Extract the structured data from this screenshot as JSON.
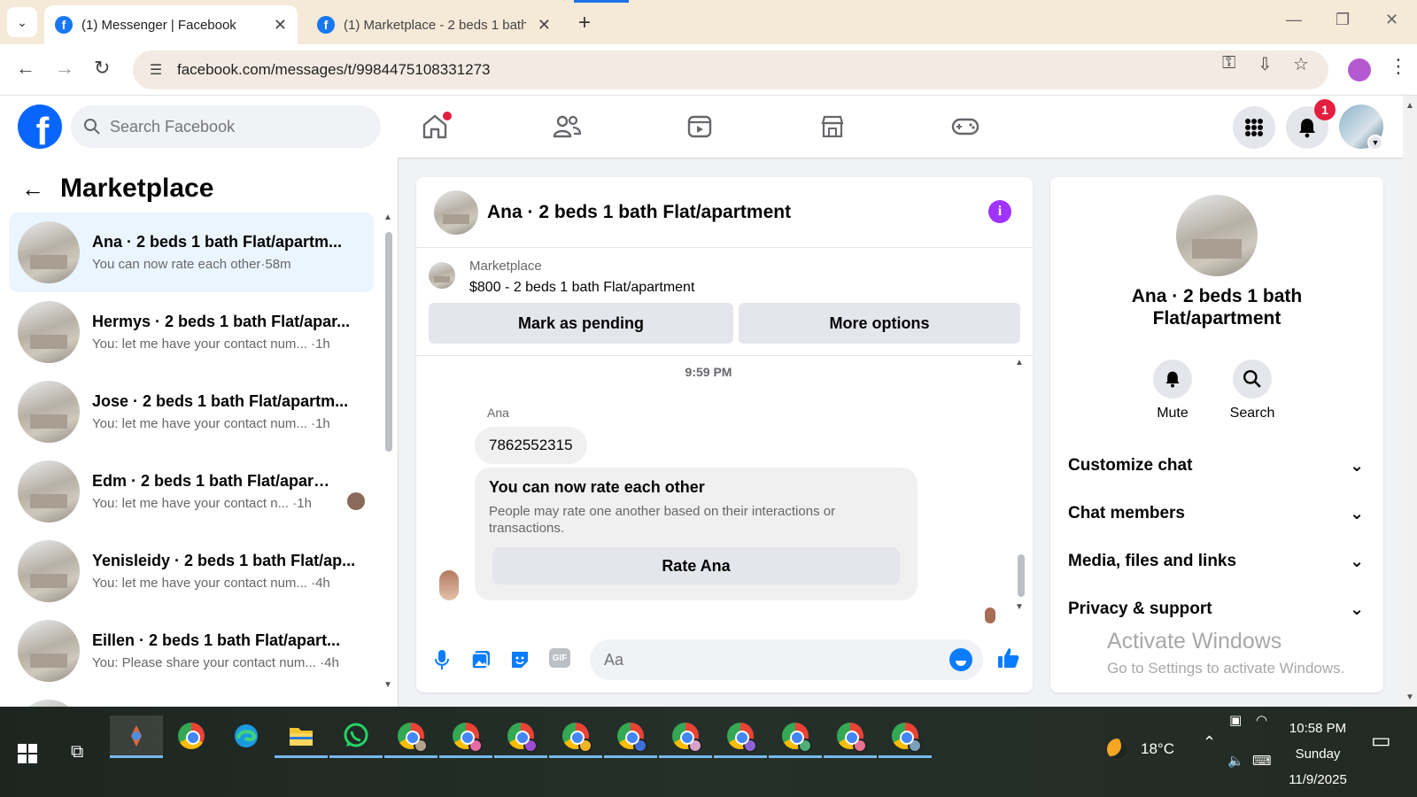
{
  "browser": {
    "tabs": [
      {
        "title": "(1) Messenger | Facebook",
        "active": true
      },
      {
        "title": "(1) Marketplace - 2 beds 1 bath",
        "active": false
      }
    ],
    "url": "facebook.com/messages/t/9984475108331273"
  },
  "header": {
    "search_placeholder": "Search Facebook",
    "notification_count": "1",
    "nav_icons": [
      "home-icon",
      "friends-icon",
      "video-icon",
      "marketplace-icon",
      "gaming-icon"
    ]
  },
  "left": {
    "title": "Marketplace",
    "conversations": [
      {
        "title": "Ana · 2 beds 1 bath Flat/apartm...",
        "message": "You can now rate each other",
        "time": "58m"
      },
      {
        "title": "Hermys · 2 beds 1 bath Flat/apar...",
        "message": "You: let me have your contact num...",
        "time": "1h"
      },
      {
        "title": "Jose · 2 beds 1 bath Flat/apartm...",
        "message": "You: let me have your contact num...",
        "time": "1h"
      },
      {
        "title": "Edm · 2 beds 1 bath Flat/apart...",
        "message": "You: let me have your contact n...",
        "time": "1h"
      },
      {
        "title": "Yenisleidy · 2 beds 1 bath Flat/ap...",
        "message": "You: let me have your contact num...",
        "time": "4h"
      },
      {
        "title": "Eillen · 2 beds 1 bath Flat/apart...",
        "message": "You: Please share your contact num...",
        "time": "4h"
      }
    ]
  },
  "chat": {
    "title": "Ana · 2 beds 1 bath Flat/apartment",
    "listing_category": "Marketplace",
    "listing_price": "$800 - 2 beds 1 bath Flat/apartment",
    "mark_pending": "Mark as pending",
    "more_options": "More options",
    "timestamp": "9:59 PM",
    "sender": "Ana",
    "message": "7862552315",
    "rate_title": "You can now rate each other",
    "rate_desc": "People may rate one another based on their interactions or transactions.",
    "rate_button": "Rate Ana",
    "composer_placeholder": "Aa"
  },
  "info": {
    "title": "Ana · 2 beds 1 bath Flat/apartment",
    "mute": "Mute",
    "search": "Search",
    "sections": [
      "Customize chat",
      "Chat members",
      "Media, files and links",
      "Privacy & support"
    ],
    "watermark_title": "Activate Windows",
    "watermark_sub": "Go to Settings to activate Windows."
  },
  "taskbar": {
    "weather": "18°C",
    "time": "10:58 PM",
    "day": "Sunday",
    "date": "11/9/2025"
  },
  "colors": {
    "facebook_blue": "#0866ff",
    "messenger_blue": "#0a7cff",
    "info_purple": "#a033ff",
    "badge_red": "#e41e3f"
  }
}
